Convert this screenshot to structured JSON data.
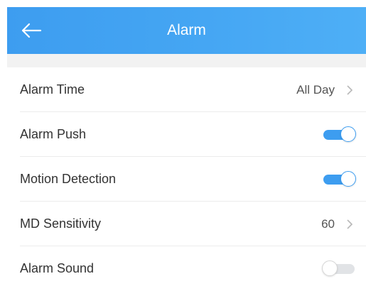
{
  "header": {
    "title": "Alarm",
    "back_icon": "arrow-left-icon"
  },
  "colors": {
    "accent": "#3d9df0",
    "background": "#ffffff",
    "divider": "#ececec"
  },
  "settings": [
    {
      "label": "Alarm Time",
      "value": "All Day",
      "control": "disclosure"
    },
    {
      "label": "Alarm Push",
      "control": "toggle",
      "on": true
    },
    {
      "label": "Motion Detection",
      "control": "toggle",
      "on": true
    },
    {
      "label": "MD Sensitivity",
      "value": "60",
      "control": "disclosure"
    },
    {
      "label": "Alarm Sound",
      "control": "toggle",
      "on": false
    }
  ]
}
